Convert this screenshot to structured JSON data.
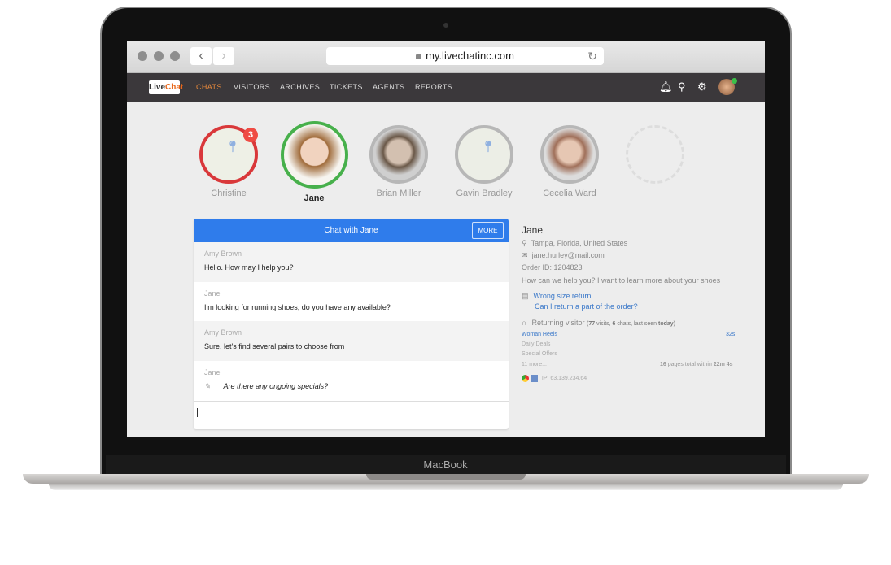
{
  "device": {
    "label": "MacBook"
  },
  "browser": {
    "url": "my.livechatinc.com",
    "back_icon": "chevron-left-icon",
    "forward_icon": "chevron-right-icon",
    "lock_icon": "lock-icon",
    "reload_icon": "reload-icon"
  },
  "app": {
    "logo": {
      "part1": "Live",
      "part2": "Chat"
    },
    "nav": [
      {
        "label": "CHATS",
        "active": true
      },
      {
        "label": "VISITORS"
      },
      {
        "label": "ARCHIVES"
      },
      {
        "label": "TICKETS"
      },
      {
        "label": "AGENTS"
      },
      {
        "label": "REPORTS"
      }
    ],
    "icons": [
      "bell-icon",
      "search-icon",
      "gear-icon",
      "avatar"
    ],
    "accent": "#e8893b",
    "online_color": "#3cc04a"
  },
  "visitors": [
    {
      "name": "Christine",
      "badge": "3",
      "status": "red",
      "type": "map"
    },
    {
      "name": "Jane",
      "status": "green",
      "active": true
    },
    {
      "name": "Brian Miller"
    },
    {
      "name": "Gavin Bradley",
      "type": "map"
    },
    {
      "name": "Cecelia Ward"
    },
    {
      "name": "",
      "empty": true
    }
  ],
  "chat": {
    "title": "Chat with Jane",
    "more": "MORE",
    "header_color": "#2f7ceb",
    "messages": [
      {
        "author": "Amy Brown",
        "text": "Hello. How may I help you?"
      },
      {
        "author": "Jane",
        "text": "I'm looking for running shoes, do you have any available?"
      },
      {
        "author": "Amy Brown",
        "text": "Sure, let's find several pairs to choose from"
      },
      {
        "author": "Jane",
        "text": "Are there any ongoing specials?",
        "typing": true
      }
    ],
    "input_value": ""
  },
  "details": {
    "name": "Jane",
    "location": "Tampa, Florida, United States",
    "email": "jane.hurley@mail.com",
    "order": "Order ID: 1204823",
    "question": "How can we help you? I want to learn more about your shoes",
    "links": [
      "Wrong size return",
      "Can I return a part of the order?"
    ],
    "returning": "Returning visitor",
    "visits": "77",
    "visits_l": " visits, ",
    "chats": "6",
    "chats_l": " chats, last seen ",
    "seen": "today",
    "pages": [
      {
        "title": "Woman Heels",
        "time": "32s"
      },
      {
        "title": "Daily Deals"
      },
      {
        "title": "Special Offers"
      }
    ],
    "more": "11 more...",
    "pages_total": "16",
    "pages_total_l": " pages total within ",
    "duration": "22m 4s",
    "ip": "IP: 63.139.234.64"
  }
}
